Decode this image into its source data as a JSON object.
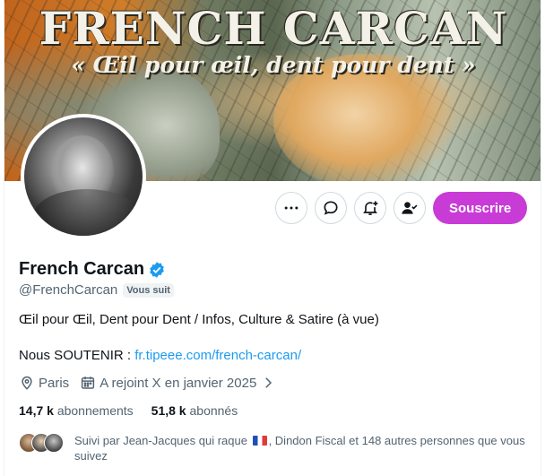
{
  "banner": {
    "title": "FRENCH CARCAN",
    "subtitle": "« Œil pour œil, dent pour dent »"
  },
  "actions": {
    "more_icon": "more-horizontal-icon",
    "message_icon": "message-icon",
    "notify_icon": "bell-plus-icon",
    "follow_icon": "person-check-icon",
    "subscribe_label": "Souscrire",
    "subscribe_color": "#c93bd6"
  },
  "profile": {
    "display_name": "French Carcan",
    "verified_color": "#1d9bf0",
    "handle": "@FrenchCarcan",
    "follows_you": "Vous suit",
    "bio": "Œil pour Œil, Dent pour Dent / Infos, Culture & Satire (à vue)",
    "support_label": "Nous SOUTENIR : ",
    "support_link": "fr.tipeee.com/french-carcan/",
    "location": "Paris",
    "joined": "A rejoint X en janvier 2025"
  },
  "stats": {
    "following_count": "14,7 k",
    "following_label": " abonnements",
    "followers_count": "51,8 k",
    "followers_label": " abonnés"
  },
  "followed_by": {
    "text_before_flag": "Suivi par Jean-Jacques qui raque ",
    "text_after_flag": ", Dindon Fiscal et 148 autres personnes que vous suivez"
  },
  "colors": {
    "link": "#1d9bf0",
    "secondary_text": "#536471",
    "primary_text": "#0f1419"
  }
}
